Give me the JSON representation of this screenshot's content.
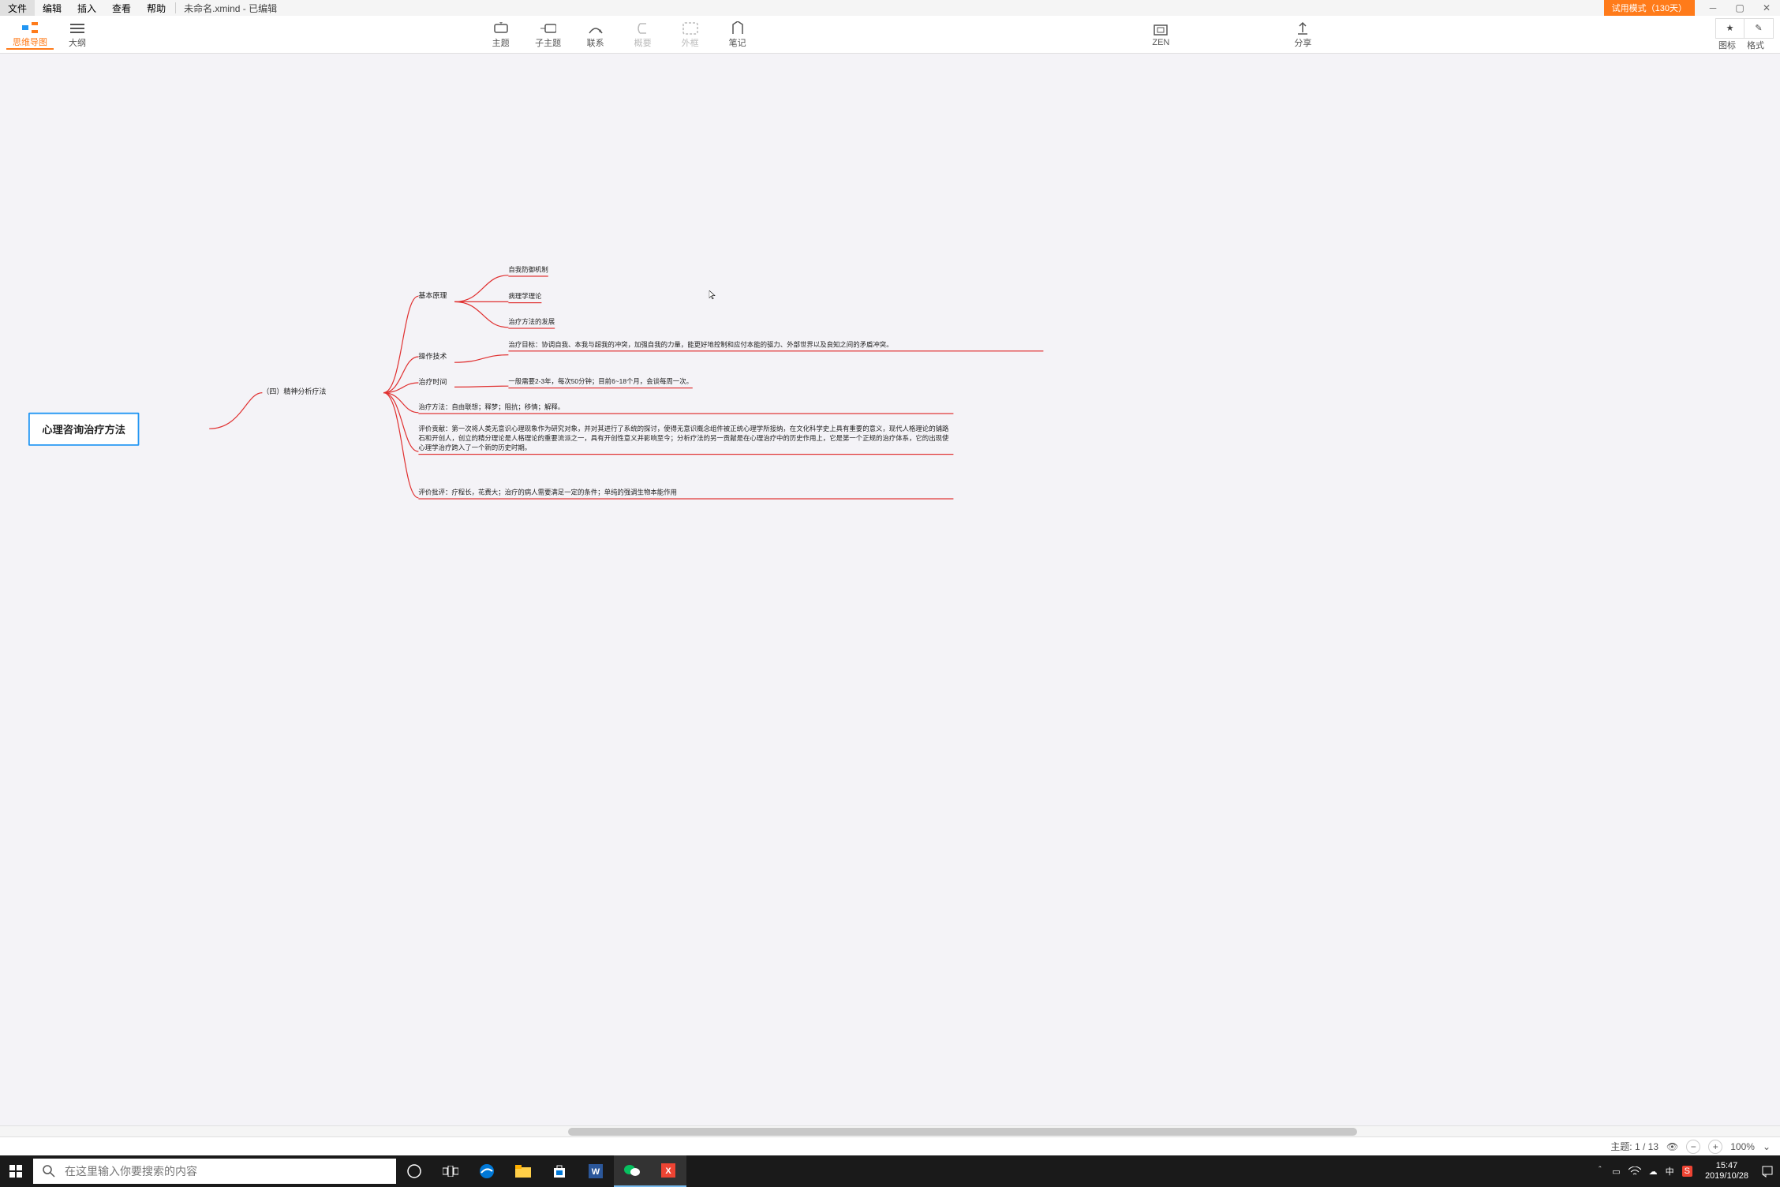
{
  "menu": {
    "file": "文件",
    "edit": "编辑",
    "insert": "插入",
    "view": "查看",
    "help": "帮助"
  },
  "doc": {
    "title": "未命名.xmind - 已编辑"
  },
  "trial": "试用模式（130天）",
  "toolbar": {
    "mindmap": "思维导图",
    "outline": "大纲",
    "topic": "主题",
    "subtopic": "子主题",
    "relation": "联系",
    "summary": "概要",
    "boundary": "外框",
    "note": "笔记",
    "zen": "ZEN",
    "share": "分享",
    "icons": "图标",
    "format": "格式"
  },
  "map": {
    "root": "心理咨询治疗方法",
    "sub1": "（四）精神分析疗法",
    "basic": "基本原理",
    "b1": "自我防御机制",
    "b2": "病理学理论",
    "b3": "治疗方法的发展",
    "op": "操作技术",
    "op1": "治疗目标：协调自我、本我与超我的冲突，加强自我的力量，能更好地控制和应付本能的驱力、外部世界以及良知之间的矛盾冲突。",
    "time": "治疗时间",
    "time1": "一般需要2-3年，每次50分钟；目前6~18个月，会谈每周一次。",
    "method": "治疗方法：自由联想；释梦；阻抗；移情；解释。",
    "contrib": "评价贡献：第一次将人类无意识心理现象作为研究对象，并对其进行了系统的探讨，使得无意识概念组件被正统心理学所接纳，在文化科学史上具有重要的意义，现代人格理论的铺路石和开创人，创立的精分理论是人格理论的重要流派之一，具有开创性意义并影响至今；分析疗法的另一贡献是在心理治疗中的历史作用上，它是第一个正规的治疗体系，它的出现使心理学治疗跨入了一个新的历史时期。",
    "crit": "评价批评：疗程长，花费大；治疗的病人需要满足一定的条件；单纯的强调生物本能作用"
  },
  "status": {
    "topic": "主题: 1 / 13",
    "zoom": "100%"
  },
  "taskbar": {
    "search_ph": "在这里输入你要搜索的内容",
    "time": "15:47",
    "date": "2019/10/28"
  }
}
